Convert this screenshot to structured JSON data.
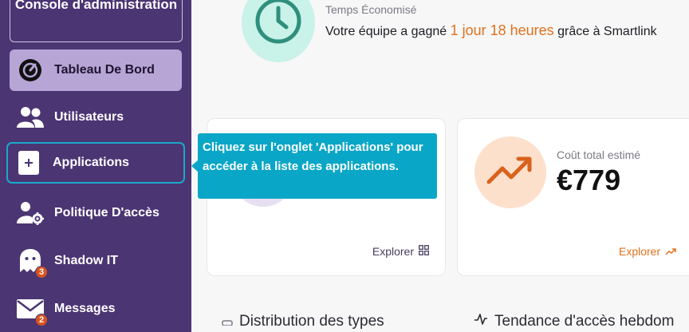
{
  "sidebar": {
    "console_label": "Console d'administration",
    "items": [
      {
        "label": "Tableau De Bord",
        "icon": "dashboard-gauge-icon"
      },
      {
        "label": "Utilisateurs",
        "icon": "users-icon"
      },
      {
        "label": "Applications",
        "icon": "plus-square-icon"
      },
      {
        "label": "Politique D'accès",
        "icon": "user-gear-icon"
      },
      {
        "label": "Shadow IT",
        "icon": "ghost-icon",
        "badge": "3"
      },
      {
        "label": "Messages",
        "icon": "envelope-icon",
        "badge": "2"
      }
    ]
  },
  "tooltip": {
    "text": "Cliquez sur l'onglet 'Applications' pour accéder à la liste des applications."
  },
  "time_saved": {
    "label": "Temps Économisé",
    "text_before": "Votre équipe a gagné ",
    "highlight": "1 jour 18 heures",
    "text_after": " grâce à Smartlink"
  },
  "cards": {
    "left": {
      "explore_label": "Explorer"
    },
    "right": {
      "label": "Coût total estimé",
      "value": "€779",
      "explore_label": "Explorer"
    }
  },
  "sections": {
    "left_heading": "Distribution des types",
    "right_heading": "Tendance d'accès hebdom"
  },
  "colors": {
    "sidebar_bg": "#4b3573",
    "active_item_bg": "#b7a5d6",
    "tooltip_bg": "#0aa6c7",
    "accent_orange": "#e0711c",
    "clock_circle_bg": "#c9f2e8",
    "trend_circle_bg": "#fde0cc"
  }
}
